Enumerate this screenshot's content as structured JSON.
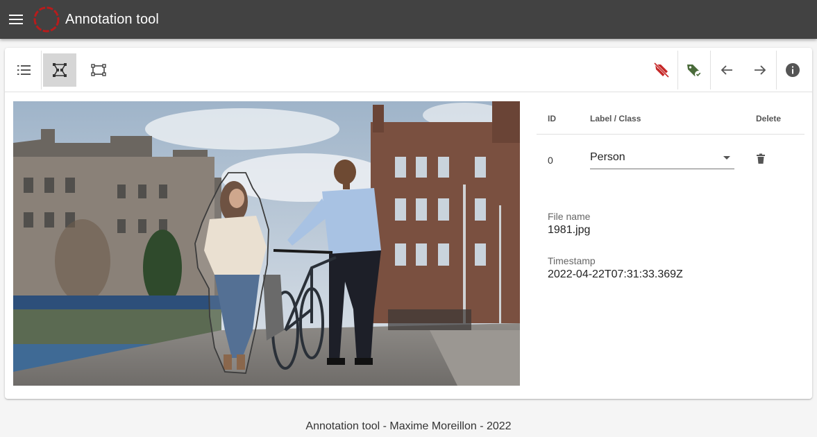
{
  "app": {
    "title": "Annotation tool",
    "bar_color": "#424242"
  },
  "toolbar": {
    "left_buttons": [
      {
        "name": "list-icon",
        "active": false
      },
      {
        "name": "polygon-tool-icon",
        "active": true
      },
      {
        "name": "rectangle-tool-icon",
        "active": false
      }
    ],
    "right_buttons": [
      {
        "name": "remove-label-icon",
        "color": "#c62828"
      },
      {
        "name": "add-label-icon",
        "color": "#4a6b3a"
      },
      {
        "name": "arrow-left-icon"
      },
      {
        "name": "arrow-right-icon"
      },
      {
        "name": "info-icon"
      }
    ]
  },
  "annotations": {
    "headers": {
      "id": "ID",
      "label": "Label / Class",
      "delete": "Delete"
    },
    "rows": [
      {
        "id": "0",
        "label": "Person"
      }
    ]
  },
  "file": {
    "name_label": "File name",
    "name": "1981.jpg",
    "timestamp_label": "Timestamp",
    "timestamp": "2022-04-22T07:31:33.369Z"
  },
  "footer": {
    "text": "Annotation tool - Maxime Moreillon - 2022"
  }
}
